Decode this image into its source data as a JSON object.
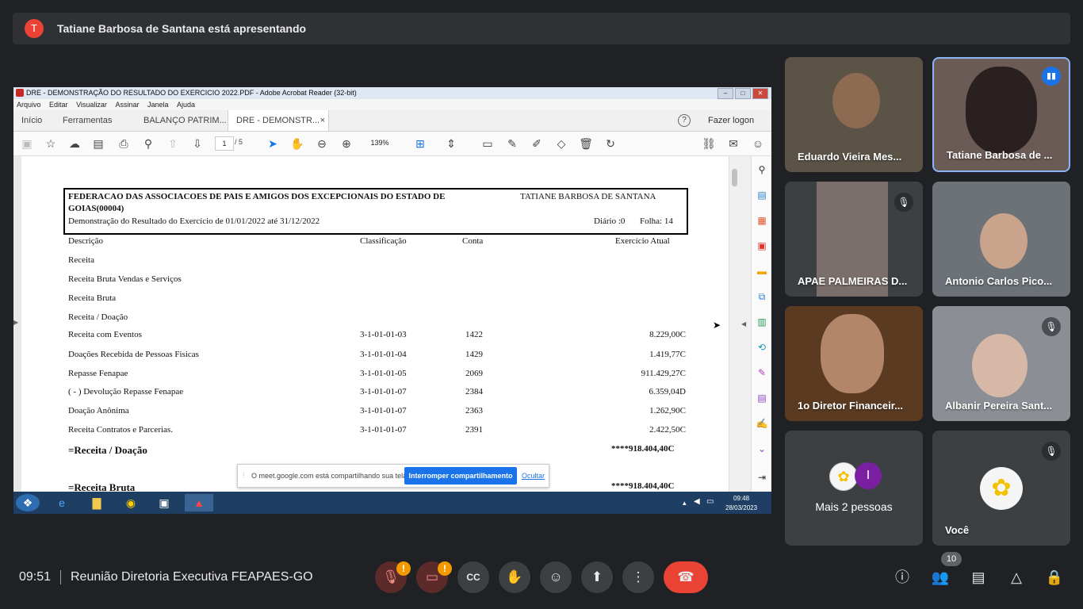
{
  "presenter_banner": {
    "initial": "T",
    "text": "Tatiane Barbosa de Santana está apresentando"
  },
  "acrobat": {
    "window_title": "DRE - DEMONSTRAÇÃO DO RESULTADO DO EXERCICIO 2022.PDF - Adobe Acrobat Reader (32-bit)",
    "menu": [
      "Arquivo",
      "Editar",
      "Visualizar",
      "Assinar",
      "Janela",
      "Ajuda"
    ],
    "tabs": {
      "home": "Início",
      "tools": "Ferramentas",
      "doc1": "BALANÇO PATRIM...",
      "doc2": "DRE - DEMONSTR...",
      "doc2_close": "×"
    },
    "help_icon": "?",
    "login": "Fazer logon",
    "page_current": "1",
    "page_total": "/ 5",
    "zoom": "139%"
  },
  "document": {
    "org": "FEDERACAO DAS ASSOCIACOES DE PAIS E AMIGOS DOS EXCEPCIONAIS DO ESTADO DE",
    "org2": "GOIAS(00004)",
    "user": "TATIANE BARBOSA DE SANTANA",
    "subtitle": "Demonstração do Resultado do Exercício de 01/01/2022 até 31/12/2022",
    "diario": "Diário :0",
    "folha": "Folha: 14",
    "col_desc": "Descrição",
    "col_class": "Classificação",
    "col_conta": "Conta",
    "col_exercicio": "Exercício Atual",
    "sections": [
      "Receita",
      "Receita Bruta Vendas e Serviços",
      "Receita Bruta",
      "Receita / Doação"
    ],
    "rows": [
      {
        "desc": "Receita com Eventos",
        "class": "3-1-01-01-03",
        "conta": "1422",
        "valor": "8.229,00C"
      },
      {
        "desc": "Doações Recebida de Pessoas Fisicas",
        "class": "3-1-01-01-04",
        "conta": "1429",
        "valor": "1.419,77C"
      },
      {
        "desc": "Repasse Fenapae",
        "class": "3-1-01-01-05",
        "conta": "2069",
        "valor": "911.429,27C"
      },
      {
        "desc": "( - ) Devolução Repasse Fenapae",
        "class": "3-1-01-01-07",
        "conta": "2384",
        "valor": "6.359,04D"
      },
      {
        "desc": "Doação Anônima",
        "class": "3-1-01-01-07",
        "conta": "2363",
        "valor": "1.262,90C"
      },
      {
        "desc": "Receita Contratos e Parcerias.",
        "class": "3-1-01-01-07",
        "conta": "2391",
        "valor": "2.422,50C"
      }
    ],
    "total1_label": "=Receita / Doação",
    "total1_value": "****918.404,40C",
    "total2_label": "=Receita Bruta",
    "total2_value": "****918.404,40C"
  },
  "share_notice": {
    "text": "O meet.google.com está compartilhando sua tela.",
    "stop": "Interromper compartilhamento",
    "hide": "Ocultar"
  },
  "taskbar": {
    "time": "09:48",
    "date": "28/03/2023"
  },
  "participants": [
    {
      "name": "Eduardo Vieira Mes..."
    },
    {
      "name": "Tatiane Barbosa de ..."
    },
    {
      "name": "APAE PALMEIRAS D..."
    },
    {
      "name": "Antonio Carlos Pico..."
    },
    {
      "name": "1o Diretor Financeir..."
    },
    {
      "name": "Albanir Pereira Sant..."
    }
  ],
  "more_people": {
    "label": "Mais 2 pessoas",
    "initial": "I"
  },
  "self_tile": {
    "name": "Você"
  },
  "bottom": {
    "time": "09:51",
    "meeting": "Reunião Diretoria Executiva FEAPAES-GO",
    "alert1": "!",
    "alert2": "!",
    "participant_count": "10"
  },
  "colors": {
    "background": "#202124",
    "tile": "#3c4043",
    "hangup": "#ea4335",
    "accent": "#1a73e8",
    "warning": "#f29900",
    "presenter_avatar": "#ea4335"
  }
}
